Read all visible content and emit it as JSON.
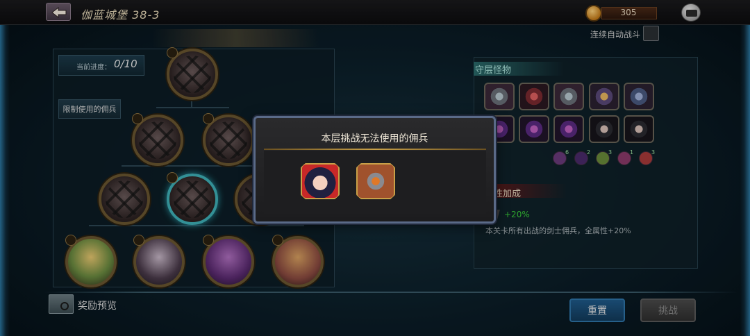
{
  "header": {
    "stage_title": "伽蓝城堡 38-3",
    "currency_value": "305",
    "auto_battle_label": "连续自动战斗",
    "back_icon": "back-arrow-icon",
    "currency_icon": "coin-icon",
    "chat_icon": "chat-icon"
  },
  "tree": {
    "progress_label": "当前进度：",
    "progress_value": "0/10",
    "restrict_button_label": "限制使用的佣兵"
  },
  "modal": {
    "title": "本层挑战无法使用的佣兵",
    "heroes": [
      "dark-haired-girl-hero",
      "armored-knight-hero"
    ]
  },
  "right_panel": {
    "guard_title": "守层怪物",
    "monster_rows": [
      [
        "grey-dragon",
        "red-beast",
        "grey-dragon",
        "gold-beast",
        "blue-beast"
      ],
      [
        "purple-dragon",
        "purple-dragon",
        "purple-dragon",
        "dark-hero",
        "dark-hero"
      ]
    ],
    "element_counts": [
      "6",
      "2",
      "3",
      "1",
      "3"
    ],
    "bonus_title": "性加成",
    "bonus_value": "+20%",
    "bonus_desc": "本关卡所有出战的剑士佣兵，全属性+20%"
  },
  "footer": {
    "reward_label": "奖励预览",
    "reset_label": "重置",
    "challenge_label": "挑战"
  },
  "colors": {
    "accent_gold": "#c8a048",
    "reset_blue": "#1f5a8a",
    "bonus_green": "#38c838"
  }
}
